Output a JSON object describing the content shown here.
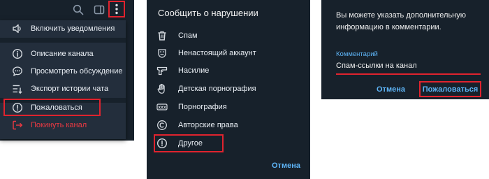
{
  "colors": {
    "panel_bg": "#17212b",
    "menu_bg": "#232e3c",
    "text": "#e9eef4",
    "accent": "#5eb5f7",
    "danger": "#ec3942",
    "highlight": "#e0232e"
  },
  "channel_toolbar": {
    "icons": [
      "search-icon",
      "side-panel-icon",
      "more-vertical-icon"
    ]
  },
  "channel_menu": {
    "items": [
      {
        "label": "Включить уведомления",
        "icon": "speaker-icon"
      },
      {
        "label": "Описание канала",
        "icon": "info-icon"
      },
      {
        "label": "Просмотреть обсуждение",
        "icon": "chat-bubble-icon"
      },
      {
        "label": "Экспорт истории чата",
        "icon": "export-icon"
      },
      {
        "label": "Пожаловаться",
        "icon": "report-icon"
      },
      {
        "label": "Покинуть канал",
        "icon": "leave-icon"
      }
    ]
  },
  "report_dialog": {
    "title": "Сообщить о нарушении",
    "reasons": [
      {
        "label": "Спам",
        "icon": "trash-icon"
      },
      {
        "label": "Ненастоящий аккаунт",
        "icon": "mask-icon"
      },
      {
        "label": "Насилие",
        "icon": "pistol-icon"
      },
      {
        "label": "Детская порнография",
        "icon": "hand-icon"
      },
      {
        "label": "Порнография",
        "icon": "xxx-icon"
      },
      {
        "label": "Авторские права",
        "icon": "copyright-icon"
      },
      {
        "label": "Другое",
        "icon": "alert-circle-icon"
      }
    ],
    "cancel_label": "Отмена"
  },
  "comment_dialog": {
    "info_text": "Вы можете указать дополнительную информацию в комментарии.",
    "field_label": "Комментарий",
    "field_value": "Спам-ссылки на канал",
    "cancel_label": "Отмена",
    "report_label": "Пожаловаться"
  }
}
